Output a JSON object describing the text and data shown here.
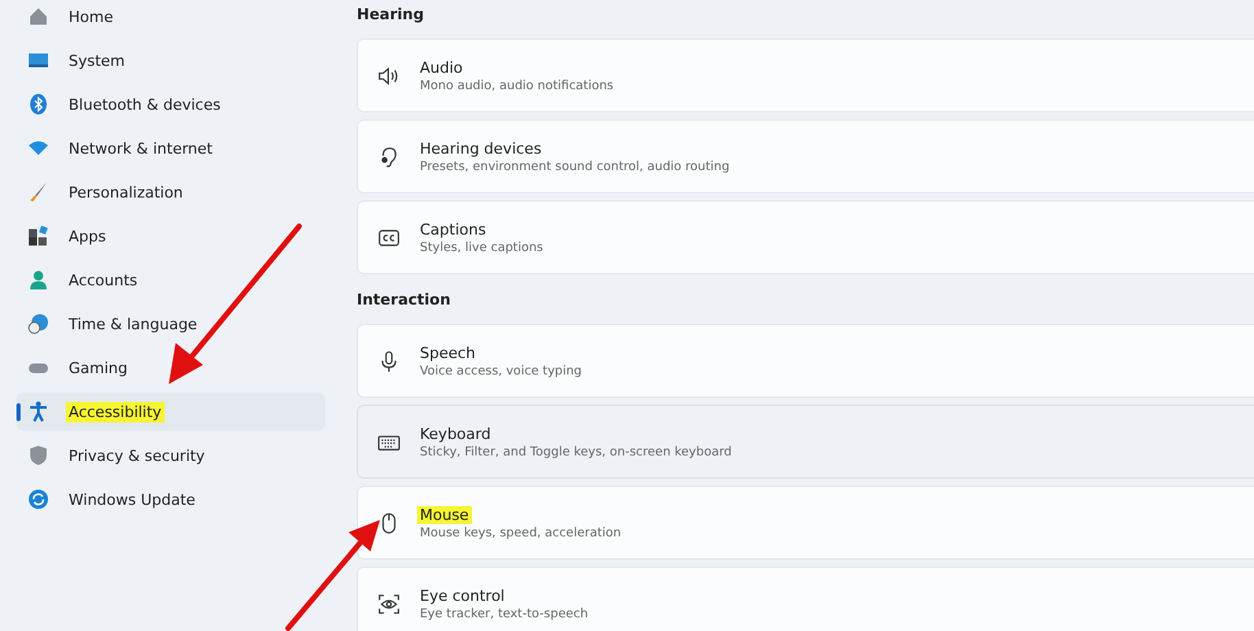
{
  "sidebar": {
    "items": [
      {
        "label": "Home",
        "selected": false,
        "highlighted": false
      },
      {
        "label": "System",
        "selected": false,
        "highlighted": false
      },
      {
        "label": "Bluetooth & devices",
        "selected": false,
        "highlighted": false
      },
      {
        "label": "Network & internet",
        "selected": false,
        "highlighted": false
      },
      {
        "label": "Personalization",
        "selected": false,
        "highlighted": false
      },
      {
        "label": "Apps",
        "selected": false,
        "highlighted": false
      },
      {
        "label": "Accounts",
        "selected": false,
        "highlighted": false
      },
      {
        "label": "Time & language",
        "selected": false,
        "highlighted": false
      },
      {
        "label": "Gaming",
        "selected": false,
        "highlighted": false
      },
      {
        "label": "Accessibility",
        "selected": true,
        "highlighted": true
      },
      {
        "label": "Privacy & security",
        "selected": false,
        "highlighted": false
      },
      {
        "label": "Windows Update",
        "selected": false,
        "highlighted": false
      }
    ]
  },
  "sections": [
    {
      "title": "Hearing",
      "cards": [
        {
          "title": "Audio",
          "subtitle": "Mono audio, audio notifications",
          "hovered": false,
          "highlighted": false
        },
        {
          "title": "Hearing devices",
          "subtitle": "Presets, environment sound control, audio routing",
          "hovered": false,
          "highlighted": false
        },
        {
          "title": "Captions",
          "subtitle": "Styles, live captions",
          "hovered": false,
          "highlighted": false
        }
      ]
    },
    {
      "title": "Interaction",
      "cards": [
        {
          "title": "Speech",
          "subtitle": "Voice access, voice typing",
          "hovered": false,
          "highlighted": false
        },
        {
          "title": "Keyboard",
          "subtitle": "Sticky, Filter, and Toggle keys, on-screen keyboard",
          "hovered": true,
          "highlighted": false
        },
        {
          "title": "Mouse",
          "subtitle": "Mouse keys, speed, acceleration",
          "hovered": false,
          "highlighted": true
        },
        {
          "title": "Eye control",
          "subtitle": "Eye tracker, text-to-speech",
          "hovered": false,
          "highlighted": false
        }
      ]
    }
  ]
}
